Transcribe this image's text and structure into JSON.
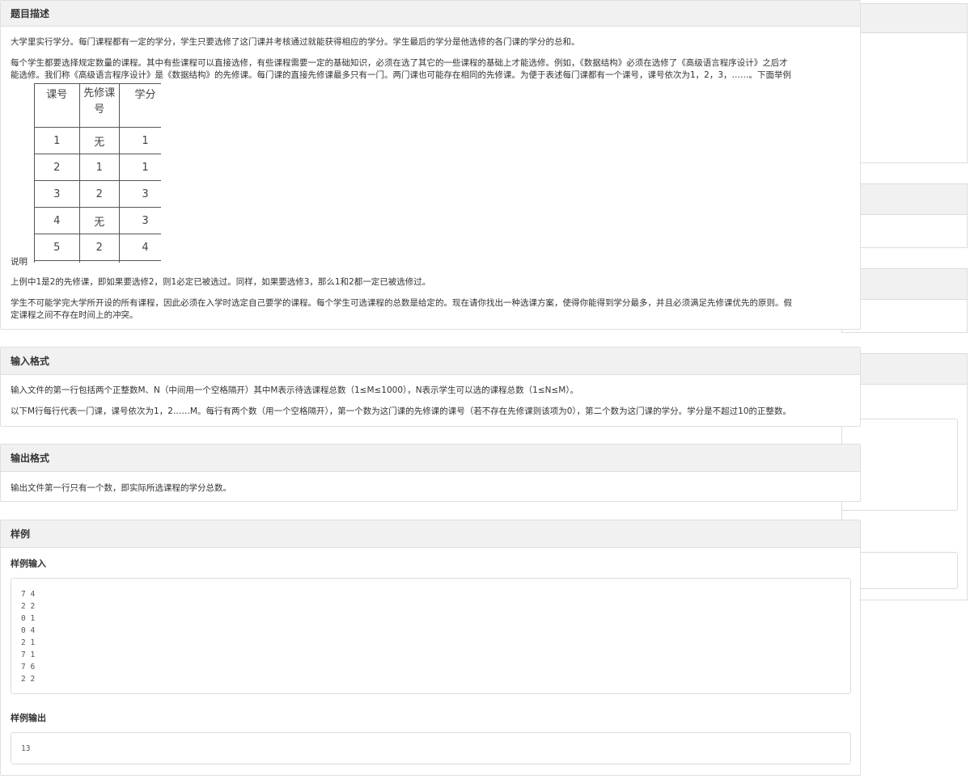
{
  "description": {
    "title": "题目描述",
    "p1": "大学里实行学分。每门课程都有一定的学分，学生只要选修了这门课并考核通过就能获得相应的学分。学生最后的学分是他选修的各门课的学分的总和。",
    "p2_line1": "每个学生都要选择规定数量的课程。其中有些课程可以直接选修，有些课程需要一定的基础知识，必须在选了其它的一些课程的基础上才能选修。例如，《数据结构》必须在选修了《高级语言程序设计》之后才",
    "p2_line2": "能选修。我们称《高级语言程序设计》是《数据结构》的先修课。每门课的直接先修课最多只有一门。两门课也可能存在相同的先修课。为便于表述每门课都有一个课号，课号依次为1，2，3，……。下面举例",
    "table_headers": [
      "课号",
      "先修课号",
      "学分"
    ],
    "table_rows": [
      [
        "1",
        "无",
        "1"
      ],
      [
        "2",
        "1",
        "1"
      ],
      [
        "3",
        "2",
        "3"
      ],
      [
        "4",
        "无",
        "3"
      ],
      [
        "5",
        "2",
        "4"
      ]
    ],
    "shuoming": "说明",
    "p3": "上例中1是2的先修课，即如果要选修2，则1必定已被选过。同样，如果要选修3，那么1和2都一定已被选修过。",
    "p4_line1": "学生不可能学完大学所开设的所有课程，因此必须在入学时选定自己要学的课程。每个学生可选课程的总数是给定的。现在请你找出一种选课方案，使得你能得到学分最多，并且必须满足先修课优先的原则。假",
    "p4_line2": "定课程之间不存在时间上的冲突。"
  },
  "input_format": {
    "title": "输入格式",
    "p1": "输入文件的第一行包括两个正整数M、N（中间用一个空格隔开）其中M表示待选课程总数（1≤M≤1000），N表示学生可以选的课程总数（1≤N≤M）。",
    "p2": "以下M行每行代表一门课，课号依次为1，2……M。每行有两个数（用一个空格隔开），第一个数为这门课的先修课的课号（若不存在先修课则该项为0），第二个数为这门课的学分。学分是不超过10的正整数。"
  },
  "output_format": {
    "title": "输出格式",
    "p1": "输出文件第一行只有一个数，即实际所选课程的学分总数。"
  },
  "sample": {
    "title": "样例",
    "input_label": "样例输入",
    "input_code": "7 4\n2 2\n0 1\n0 4\n2 1\n7 1\n7 6\n2 2",
    "output_label": "样例输出",
    "output_code": "13"
  }
}
